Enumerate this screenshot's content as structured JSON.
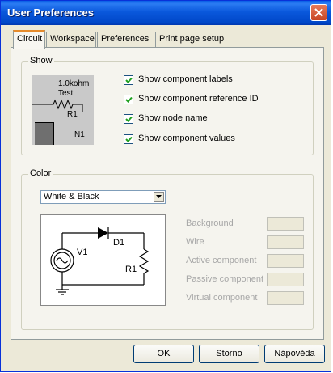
{
  "window": {
    "title": "User Preferences"
  },
  "tabs": [
    {
      "label": "Circuit",
      "active": true
    },
    {
      "label": "Workspace",
      "active": false
    },
    {
      "label": "Preferences",
      "active": false
    },
    {
      "label": "Print page setup",
      "active": false
    }
  ],
  "show": {
    "group_label": "Show",
    "preview": {
      "value": "1.0kohm",
      "name": "Test",
      "ref": "R1",
      "node": "N1"
    },
    "options": [
      {
        "label": "Show component labels",
        "checked": true
      },
      {
        "label": "Show component reference ID",
        "checked": true
      },
      {
        "label": "Show node name",
        "checked": true
      },
      {
        "label": "Show component values",
        "checked": true
      }
    ]
  },
  "color": {
    "group_label": "Color",
    "scheme": "White & Black",
    "circuit": {
      "source": "V1",
      "diode": "D1",
      "resistor": "R1"
    },
    "labels": [
      "Background",
      "Wire",
      "Active component",
      "Passive component",
      "Virtual component"
    ]
  },
  "buttons": {
    "ok": "OK",
    "cancel": "Storno",
    "help": "Nápověda"
  },
  "colors": {
    "titlebar": "#0a58dc",
    "dialog_bg": "#ece9d8",
    "close_button": "#c84523",
    "tab_highlight": "#e68b2c",
    "disabled_text": "#a7a7a7"
  }
}
